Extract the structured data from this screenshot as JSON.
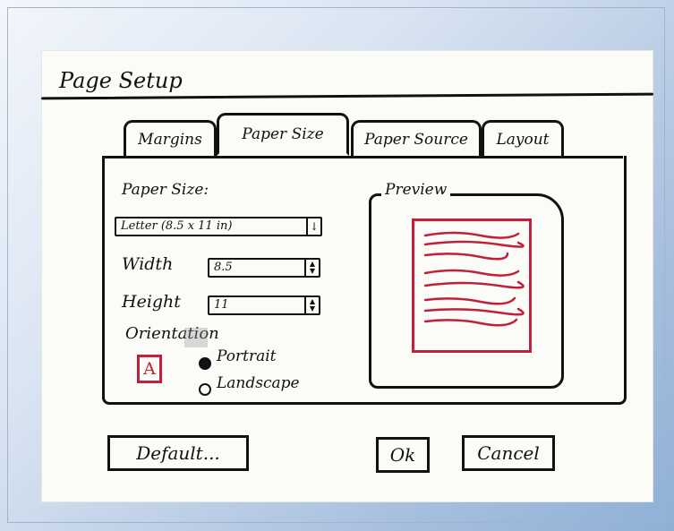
{
  "dialog": {
    "title": "Page Setup",
    "tabs": [
      {
        "label": "Margins"
      },
      {
        "label": "Paper Size"
      },
      {
        "label": "Paper Source"
      },
      {
        "label": "Layout"
      }
    ],
    "paper_size": {
      "label": "Paper Size:",
      "selected": "Letter (8.5 x 11 in)",
      "dropdown_glyph": "↓"
    },
    "width": {
      "label": "Width",
      "value": "8.5"
    },
    "height": {
      "label": "Height",
      "value": "11"
    },
    "orientation": {
      "label": "Orientation",
      "icon_letter": "A",
      "options": [
        {
          "label": "Portrait",
          "selected": true
        },
        {
          "label": "Landscape",
          "selected": false
        }
      ]
    },
    "preview": {
      "label": "Preview"
    },
    "buttons": {
      "default": "Default...",
      "ok": "Ok",
      "cancel": "Cancel"
    }
  },
  "colors": {
    "ink": "#111111",
    "accent_red": "#c0203a",
    "paper": "#fbfbf7"
  }
}
